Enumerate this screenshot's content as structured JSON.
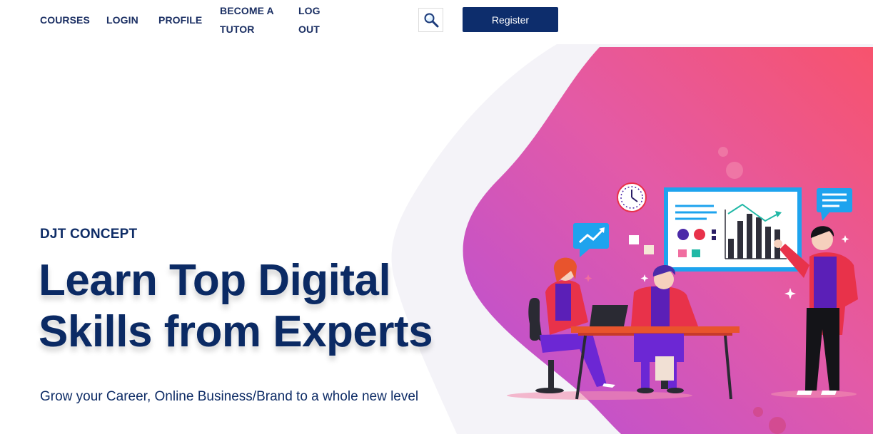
{
  "nav": {
    "courses": "COURSES",
    "login": "LOGIN",
    "profile": "PROFILE",
    "become_tutor": "BECOME A TUTOR",
    "logout": "LOG OUT",
    "search_icon": "magnifier-icon",
    "register": "Register"
  },
  "hero": {
    "brand": "DJT CONCEPT",
    "headline": "Learn Top Digital Skills from Experts",
    "subtitle": "Grow your Career, Online Business/Brand to a whole new level"
  },
  "colors": {
    "navy": "#0d2d6c",
    "pink": "#f04f7a",
    "purple": "#b94fd6",
    "accent_red": "#e8324a"
  }
}
